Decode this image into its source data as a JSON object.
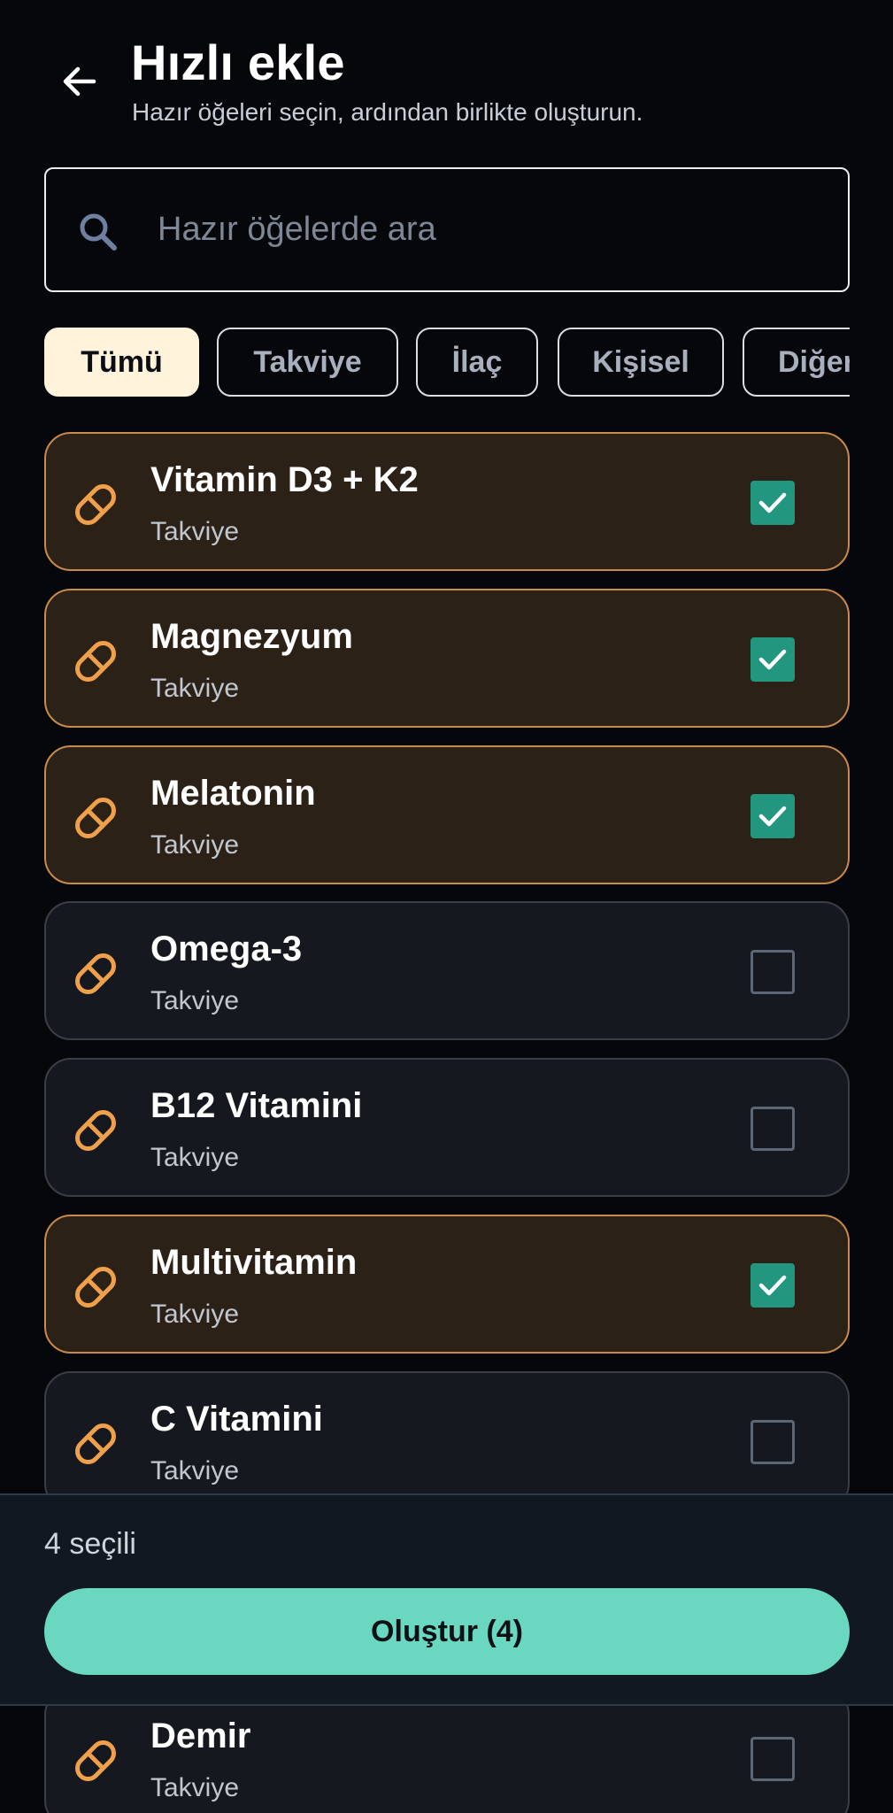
{
  "header": {
    "title": "Hızlı ekle",
    "subtitle": "Hazır öğeleri seçin, ardından birlikte oluşturun."
  },
  "search": {
    "placeholder": "Hazır öğelerde ara",
    "value": ""
  },
  "filters": [
    {
      "label": "Tümü",
      "active": true
    },
    {
      "label": "Takviye",
      "active": false
    },
    {
      "label": "İlaç",
      "active": false
    },
    {
      "label": "Kişisel",
      "active": false
    },
    {
      "label": "Diğer",
      "active": false
    }
  ],
  "items": [
    {
      "title": "Vitamin D3 + K2",
      "category": "Takviye",
      "selected": true
    },
    {
      "title": "Magnezyum",
      "category": "Takviye",
      "selected": true
    },
    {
      "title": "Melatonin",
      "category": "Takviye",
      "selected": true
    },
    {
      "title": "Omega-3",
      "category": "Takviye",
      "selected": false
    },
    {
      "title": "B12 Vitamini",
      "category": "Takviye",
      "selected": false
    },
    {
      "title": "Multivitamin",
      "category": "Takviye",
      "selected": true
    },
    {
      "title": "C Vitamini",
      "category": "Takviye",
      "selected": false
    },
    {
      "title": "Demir",
      "category": "Takviye",
      "selected": false
    }
  ],
  "footer": {
    "selected_count": "4 seçili",
    "create_label": "Oluştur (4)"
  },
  "colors": {
    "background": "#05070a",
    "accent": "#6ad7c0",
    "check": "#22967f",
    "pill": "#f0a04b",
    "selected_card": "#2c2117",
    "selected_border": "#c98a4d"
  },
  "icons": {
    "back": "arrow-left-icon",
    "search": "search-icon",
    "item": "pill-icon",
    "check": "checkmark-icon"
  }
}
